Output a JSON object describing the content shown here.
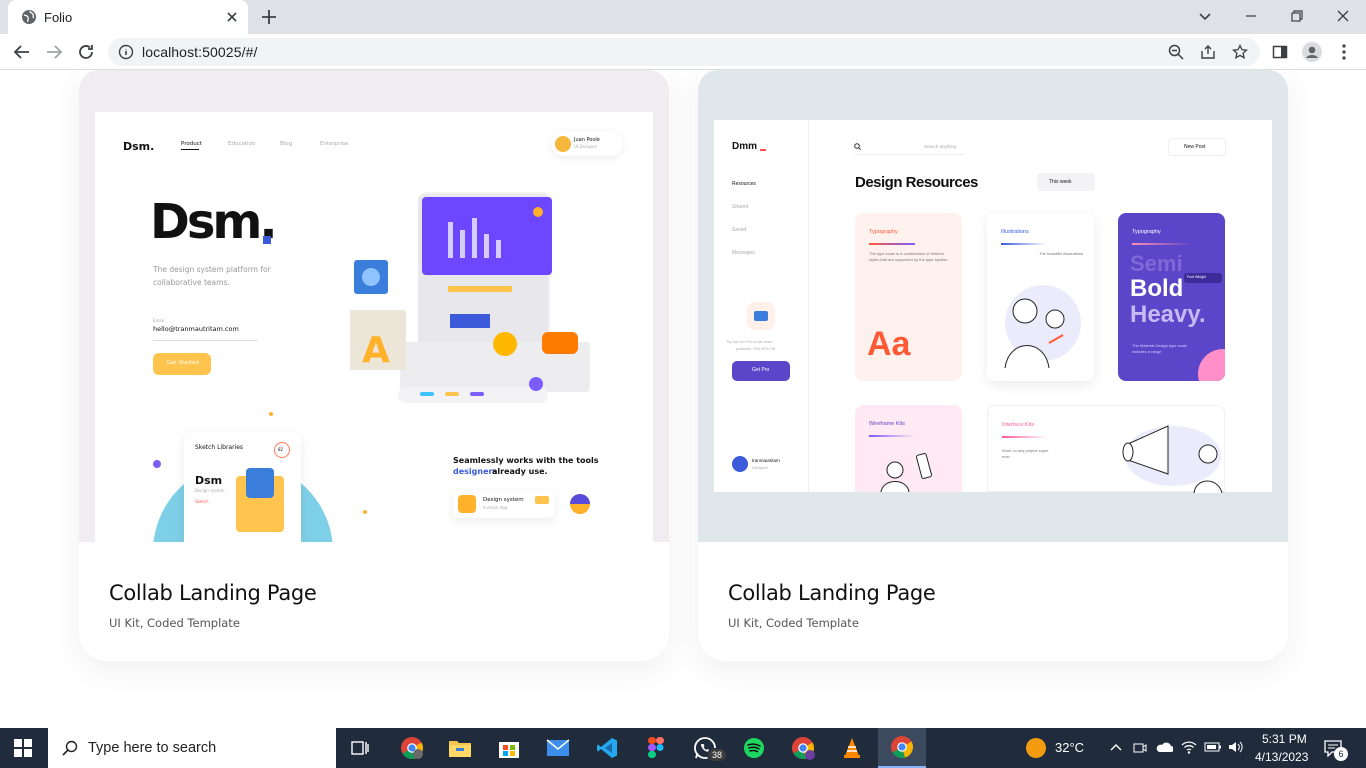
{
  "browser": {
    "tab_title": "Folio",
    "url": "localhost:50025/#/"
  },
  "cards": [
    {
      "title": "Collab Landing Page",
      "subtitle": "UI Kit, Coded Template",
      "preview": {
        "logo": "Dsm.",
        "nav": [
          "Product",
          "Education",
          "Blog",
          "Enterprise"
        ],
        "user_name": "Juan Poole",
        "user_role": "UI Designer",
        "hero": "Dsm.",
        "tagline_1": "The design system platform for",
        "tagline_2": "collaborative teams.",
        "email_label": "Email",
        "email": "hello@tranmautritam.com",
        "cta": "Get Started",
        "lib_title": "Sketch Libraries",
        "lib_count": "82",
        "lib_name": "Dsm",
        "lib_desc": "Design system",
        "lib_tag": "Sketch",
        "tools_line_1": "Seamlessly works with the tools",
        "tools_line_2a": "designers",
        "tools_line_2b": " already use.",
        "ds_label": "Design system",
        "ds_sub": "Invision App"
      }
    },
    {
      "title": "Collab Landing Page",
      "subtitle": "UI Kit, Coded Template",
      "preview": {
        "logo": "Dmm",
        "search_ph": "Search anything",
        "new_post": "New Post",
        "heading": "Design Resources",
        "filter": "This week",
        "side": [
          "Resources",
          "Shared",
          "Saved",
          "Messages"
        ],
        "upgrade_1": "Try out our Pro to be more",
        "upgrade_2": "powerful. Get 30% Off",
        "get_pro": "Get Pro",
        "user_name": "tranmautritam",
        "user_role": "Designer",
        "card_typo": "Typography",
        "card_typo_desc": "The type scale is a combination of thirteen styles that are supported by the type system.",
        "card_illus": "Illustrations",
        "card_illus_desc": "The beautiful illustrations",
        "card_typo2": "Typography",
        "semi": "Semi",
        "bold": "Bold",
        "heavy": "Heavy.",
        "font_weight": "Font Weight",
        "typo2_desc": "The Material Design type scale includes a range",
        "aa": "Aa",
        "wire": "Wireframe Kits",
        "iface": "Interface Kits",
        "iface_desc": "Work on any project super ever"
      }
    }
  ],
  "taskbar": {
    "search_placeholder": "Type here to search",
    "weather": "32°C",
    "time": "5:31 PM",
    "date": "4/13/2023",
    "whatsapp_badge": "38",
    "notif_count": "6"
  }
}
